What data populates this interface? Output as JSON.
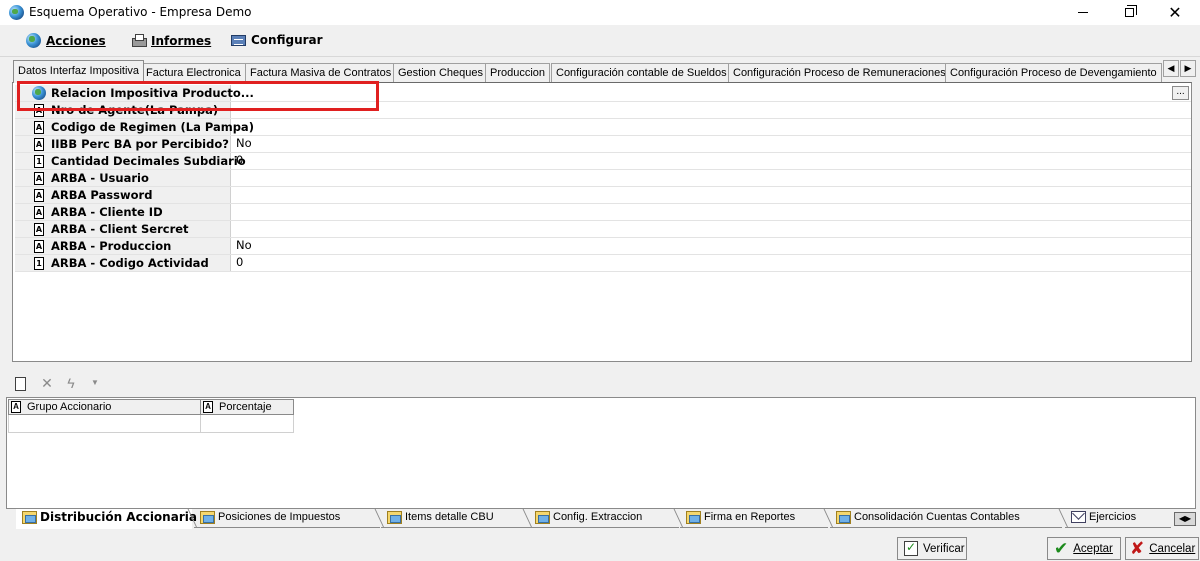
{
  "window": {
    "title": "Esquema Operativo - Empresa Demo"
  },
  "menu": {
    "acciones": "Acciones",
    "informes": "Informes",
    "configurar": "Configurar"
  },
  "tabs": [
    "Datos Interfaz Impositiva",
    "Factura Electronica",
    "Factura Masiva de Contratos",
    "Gestion Cheques",
    "Produccion",
    "Configuración contable de Sueldos",
    "Configuración Proceso de Remuneraciones",
    "Configuración Proceso de Devengamiento"
  ],
  "properties": [
    {
      "name": "Relacion Impositiva Producto...",
      "value": "",
      "type": "globe"
    },
    {
      "name": "Nro de Agente(La Pampa)",
      "value": "",
      "type": "A"
    },
    {
      "name": "Codigo de Regimen (La Pampa)",
      "value": "",
      "type": "A"
    },
    {
      "name": "IIBB Perc BA por Percibido?",
      "value": "No",
      "type": "A"
    },
    {
      "name": "Cantidad Decimales Subdiario",
      "value": "0",
      "type": "1"
    },
    {
      "name": "ARBA - Usuario",
      "value": "",
      "type": "A"
    },
    {
      "name": "ARBA Password",
      "value": "",
      "type": "A"
    },
    {
      "name": "ARBA - Cliente ID",
      "value": "",
      "type": "A"
    },
    {
      "name": "ARBA - Client Sercret",
      "value": "",
      "type": "A"
    },
    {
      "name": "ARBA - Produccion",
      "value": "No",
      "type": "A"
    },
    {
      "name": "ARBA - Codigo Actividad",
      "value": "0",
      "type": "1"
    }
  ],
  "ellipsis": "...",
  "lower_grid": {
    "columns": [
      "Grupo Accionario",
      "Porcentaje"
    ]
  },
  "bottom_tabs": [
    "Distribución Accionaria",
    "Posiciones de Impuestos",
    "Items detalle CBU",
    "Config. Extraccion",
    "Firma en Reportes",
    "Consolidación Cuentas Contables",
    "Ejercicios"
  ],
  "buttons": {
    "verificar": "Verificar",
    "aceptar": "Aceptar",
    "cancelar": "Cancelar"
  },
  "colors": {
    "highlight": "#e02020",
    "accept": "#1c8a1c",
    "cancel": "#c01818"
  }
}
